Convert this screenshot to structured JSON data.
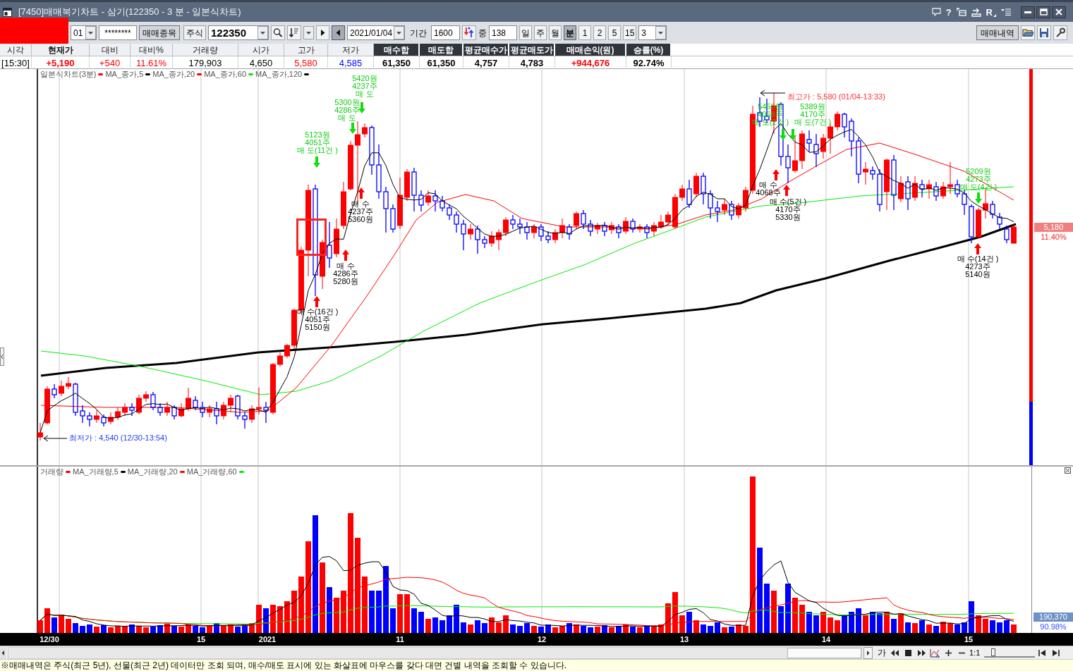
{
  "title_bar": {
    "title": "[7450]매매복기차트 - 삼기(122350 - 3 분 - 일본식차트)",
    "help_button": "?",
    "r_button": "R"
  },
  "toolbar": {
    "account": "01",
    "password": "********",
    "stock_button": "매매종목",
    "market": "주식",
    "code": "122350",
    "nav_buttons": [
      {
        "kind": "next",
        "pressed": false
      },
      {
        "kind": "prev",
        "pressed": true
      }
    ],
    "date": "2021/01/04",
    "period_label": "기간",
    "period": "1600",
    "count_label": "중",
    "count": "138",
    "intervals": [
      {
        "label": "일",
        "selected": false
      },
      {
        "label": "주",
        "selected": false
      },
      {
        "label": "월",
        "selected": false
      },
      {
        "label": "분",
        "selected": true
      },
      {
        "label": "1",
        "selected": false
      },
      {
        "label": "2",
        "selected": false
      },
      {
        "label": "5",
        "selected": false
      },
      {
        "label": "15",
        "selected": false
      }
    ],
    "unit": "3",
    "history_button": "매매내역"
  },
  "quote_table": {
    "columns": [
      {
        "header": "시각",
        "value": "[15:30]",
        "kind": "plain",
        "color": "#000000"
      },
      {
        "header": "현재가",
        "value": "+5,190",
        "kind": "key",
        "color": "#ff0000"
      },
      {
        "header": "대비",
        "value": "+540",
        "kind": "plain",
        "color": "#ff0000"
      },
      {
        "header": "대비%",
        "value": "11.61%",
        "kind": "plain",
        "color": "#ff0000"
      },
      {
        "header": "거래량",
        "value": "179,903",
        "kind": "plain",
        "color": "#000000"
      },
      {
        "header": "시가",
        "value": "4,650",
        "kind": "plain",
        "color": "#000000"
      },
      {
        "header": "고가",
        "value": "5,580",
        "kind": "plain",
        "color": "#ff0000"
      },
      {
        "header": "저가",
        "value": "4,585",
        "kind": "plain",
        "color": "#0000ff"
      },
      {
        "header": "매수합",
        "value": "61,350",
        "kind": "summary",
        "color": "#000000"
      },
      {
        "header": "매도합",
        "value": "61,350",
        "kind": "summary",
        "color": "#000000"
      },
      {
        "header": "평균매수가",
        "value": "4,757",
        "kind": "summary",
        "color": "#000000"
      },
      {
        "header": "평균매도가",
        "value": "4,783",
        "kind": "summary",
        "color": "#000000"
      },
      {
        "header": "매매손익(원)",
        "value": "+944,676",
        "kind": "summary",
        "color": "#ff0000"
      },
      {
        "header": "승률(%)",
        "value": "92.74%",
        "kind": "summary",
        "color": "#000000"
      }
    ]
  },
  "price_chart": {
    "legend": [
      {
        "label": "일본식차트(3분)",
        "color": "#ff0000"
      },
      {
        "label": "MA_종가,5",
        "color": "#000000"
      },
      {
        "label": "MA_종가,20",
        "color": "#ff0000"
      },
      {
        "label": "MA_종가,60",
        "color": "#00ee00"
      },
      {
        "label": "MA_종가,120",
        "color": "#000000"
      }
    ],
    "high_marker": "최고가 : 5,580 (01/04-13:33)",
    "low_marker": "최저가 : 4,540 (12/30-13:54)",
    "trade_marks": [
      {
        "kind": "sell",
        "lines": [
          "5420원",
          "4237주",
          "매 도"
        ]
      },
      {
        "kind": "sell",
        "lines": [
          "5300원",
          "4286주",
          "매 도"
        ]
      },
      {
        "kind": "sell",
        "lines": [
          "5123원",
          "4051주",
          "매 도(11건 )"
        ]
      },
      {
        "kind": "buy",
        "lines": [
          "매 수",
          "4237주",
          "5360원"
        ]
      },
      {
        "kind": "buy",
        "lines": [
          "매 수",
          "4286주",
          "5280원"
        ]
      },
      {
        "kind": "buy",
        "lines": [
          "매 수(16건 )",
          "4051주",
          "5150원"
        ]
      },
      {
        "kind": "sell",
        "lines": [
          "5450원",
          "4068주",
          "매 도(2건 )"
        ]
      },
      {
        "kind": "sell",
        "lines": [
          "5389원",
          "4170주",
          "매 도(7건 )"
        ]
      },
      {
        "kind": "buy",
        "lines": [
          "매 수",
          "4068주"
        ]
      },
      {
        "kind": "buy",
        "lines": [
          "매 수(5건 )",
          "4170주",
          "5330원"
        ]
      },
      {
        "kind": "sell",
        "lines": [
          "5209원",
          "4273주",
          "매 도(4건 )"
        ]
      },
      {
        "kind": "buy",
        "lines": [
          "매 수(14건 )",
          "4273주",
          "5140원"
        ]
      }
    ],
    "current_price": "5,180",
    "change_rate": "11.40%",
    "strength_bar": {
      "level": 0.84
    }
  },
  "volume_chart": {
    "legend": [
      {
        "label": "거래량",
        "color": "#ff0000"
      },
      {
        "label": "MA_거래량,5",
        "color": "#000000"
      },
      {
        "label": "MA_거래량,20",
        "color": "#ff0000"
      },
      {
        "label": "MA_거래량,60",
        "color": "#00ee00"
      }
    ],
    "current_volume": "190,370",
    "volume_ratio": "90.98%"
  },
  "x_axis": {
    "labels": [
      "12/30",
      "15",
      "2021",
      "11",
      "12",
      "13",
      "14",
      "15"
    ]
  },
  "navigator": {
    "text_button": "가",
    "zoom_label": "1:1",
    "zoom_slider": {
      "level": 0.15
    }
  },
  "status_text": "※매매내역은 주식(최근 5년), 선물(최근 2년) 데이터만 조회 되며, 매수/매도 표시에 있는 화살표에 마우스를 갖다 대면 건별 내역을 조회할 수 있습니다."
}
